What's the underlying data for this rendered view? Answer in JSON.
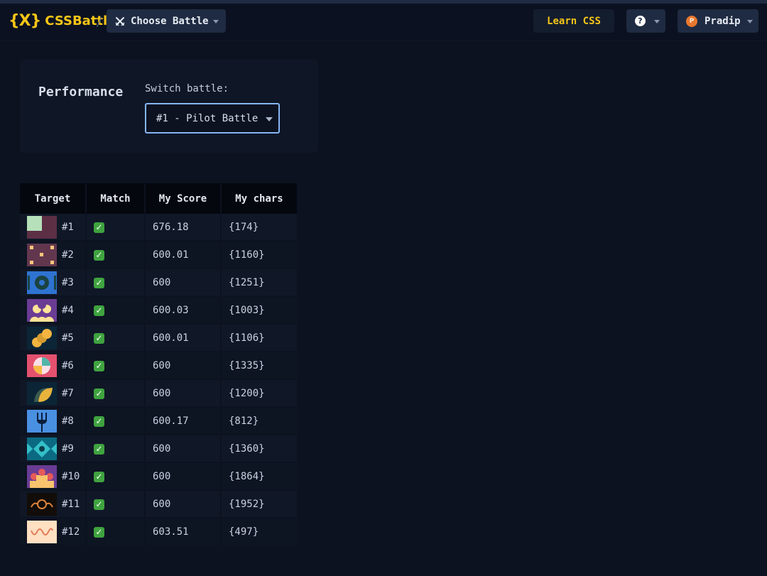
{
  "header": {
    "logo_mark": "{X}",
    "logo_text": "CSSBattle",
    "separator": "/",
    "choose_battle_label": "Choose Battle",
    "learn_css_label": "Learn CSS",
    "help_label": "?",
    "user": {
      "initial": "P",
      "name": "Pradip"
    }
  },
  "performance": {
    "title": "Performance",
    "switch_label": "Switch battle:",
    "selected_battle": "#1 - Pilot Battle"
  },
  "table": {
    "headers": [
      "Target",
      "Match",
      "My Score",
      "My chars"
    ],
    "rows": [
      {
        "target": "#1",
        "match": "✓",
        "score": "676.18",
        "chars": "{174}",
        "thumb": "t1"
      },
      {
        "target": "#2",
        "match": "✓",
        "score": "600.01",
        "chars": "{1160}",
        "thumb": "t2"
      },
      {
        "target": "#3",
        "match": "✓",
        "score": "600",
        "chars": "{1251}",
        "thumb": "t3"
      },
      {
        "target": "#4",
        "match": "✓",
        "score": "600.03",
        "chars": "{1003}",
        "thumb": "t4"
      },
      {
        "target": "#5",
        "match": "✓",
        "score": "600.01",
        "chars": "{1106}",
        "thumb": "t5"
      },
      {
        "target": "#6",
        "match": "✓",
        "score": "600",
        "chars": "{1335}",
        "thumb": "t6"
      },
      {
        "target": "#7",
        "match": "✓",
        "score": "600",
        "chars": "{1200}",
        "thumb": "t7"
      },
      {
        "target": "#8",
        "match": "✓",
        "score": "600.17",
        "chars": "{812}",
        "thumb": "t8"
      },
      {
        "target": "#9",
        "match": "✓",
        "score": "600",
        "chars": "{1360}",
        "thumb": "t9"
      },
      {
        "target": "#10",
        "match": "✓",
        "score": "600",
        "chars": "{1864}",
        "thumb": "t10"
      },
      {
        "target": "#11",
        "match": "✓",
        "score": "600",
        "chars": "{1952}",
        "thumb": "t11"
      },
      {
        "target": "#12",
        "match": "✓",
        "score": "603.51",
        "chars": "{497}",
        "thumb": "t12"
      }
    ]
  },
  "colors": {
    "accent_yellow": "#f5c518",
    "background": "#0c1220",
    "select_border": "#86b6f6",
    "check_green": "#3fa33f"
  }
}
